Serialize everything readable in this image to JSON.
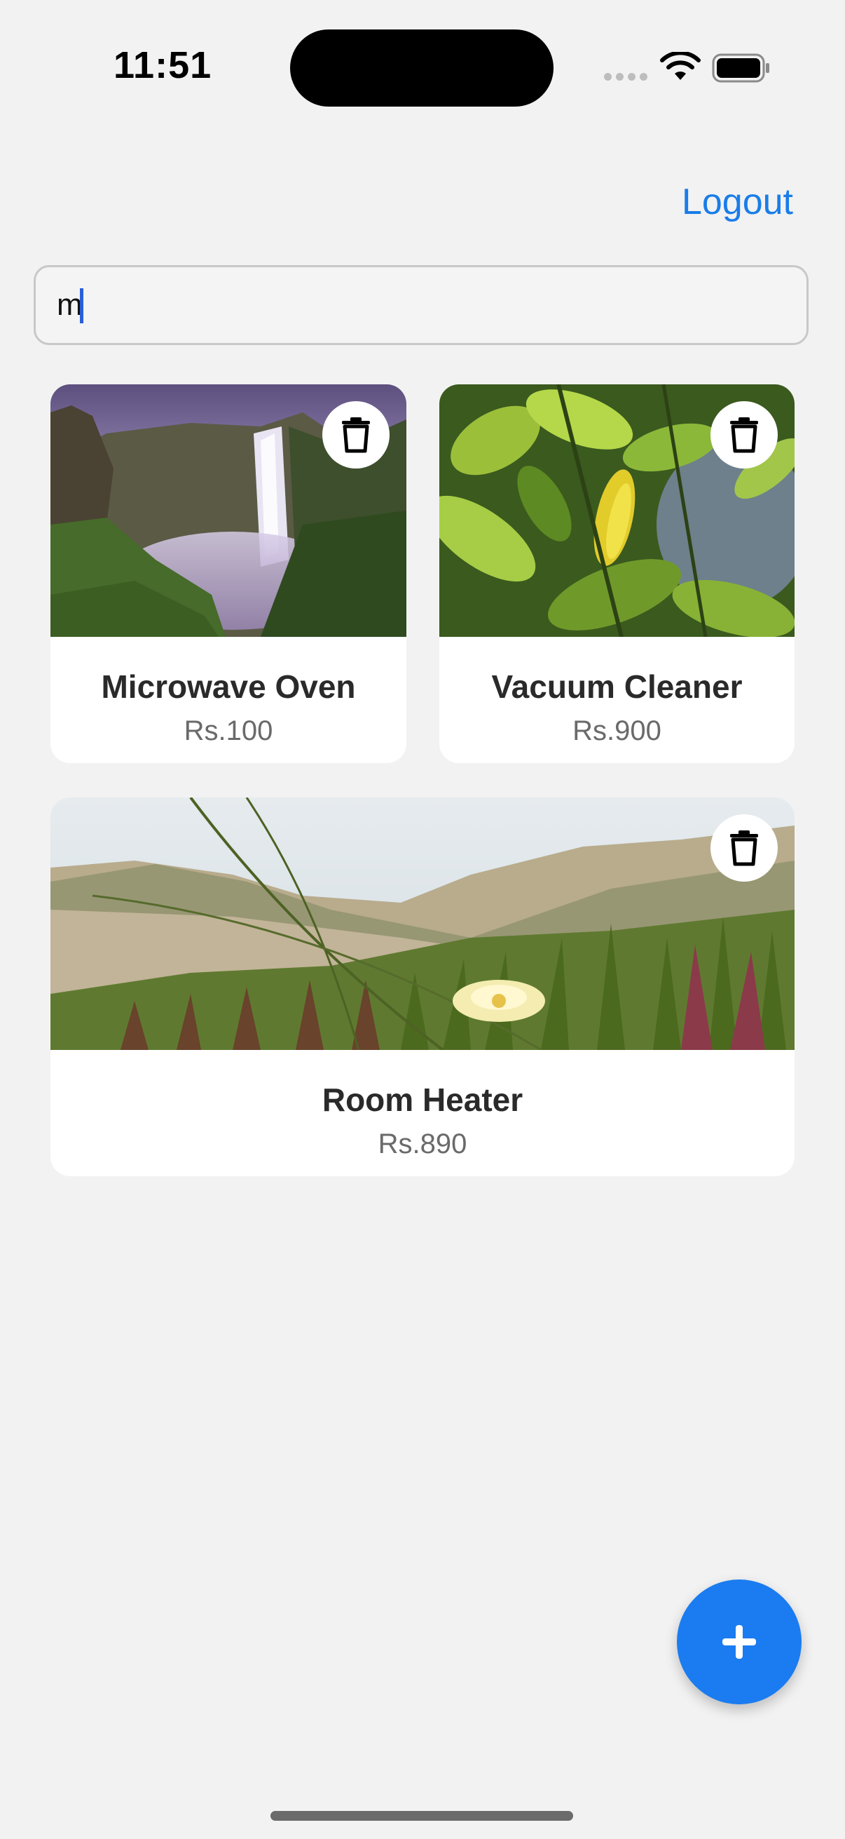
{
  "status_bar": {
    "time": "11:51",
    "icons": [
      "signal-dots-icon",
      "wifi-icon",
      "battery-icon"
    ]
  },
  "header": {
    "logout_label": "Logout"
  },
  "search": {
    "value": "m",
    "placeholder": ""
  },
  "items": [
    {
      "title": "Microwave Oven",
      "price": "Rs.100",
      "image": "waterfall-photo"
    },
    {
      "title": "Vacuum Cleaner",
      "price": "Rs.900",
      "image": "leaves-photo"
    },
    {
      "title": "Room Heater",
      "price": "Rs.890",
      "image": "dune-flower-photo"
    }
  ],
  "fab": {
    "icon": "plus-icon"
  },
  "colors": {
    "accent": "#1a7cf0",
    "background": "#f2f2f2",
    "card": "#ffffff"
  }
}
